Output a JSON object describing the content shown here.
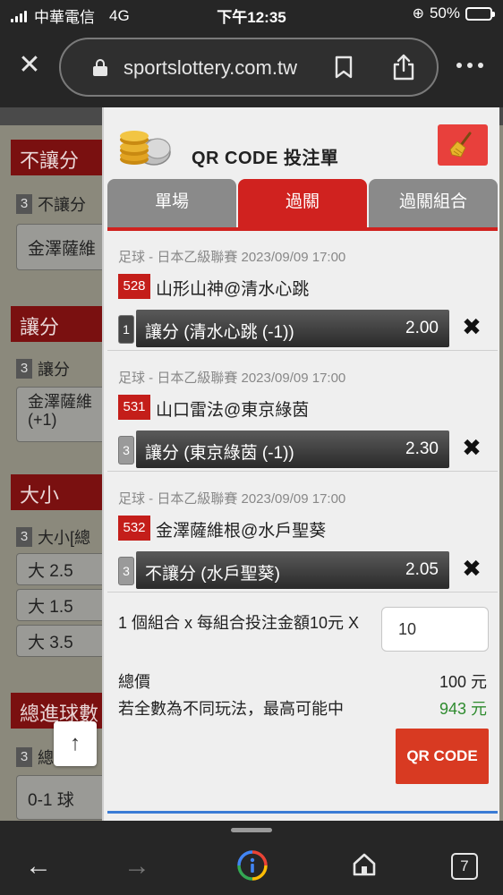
{
  "status_bar": {
    "carrier": "中華電信",
    "network": "4G",
    "time": "下午12:35",
    "battery": "50%",
    "battery_level": 0.5
  },
  "browser": {
    "url": "sportslottery.com.tw"
  },
  "background_page": {
    "sections": [
      {
        "title": "不讓分",
        "sub_count": "3",
        "sub_label": "不讓分",
        "options": [
          "金澤薩維"
        ]
      },
      {
        "title": "讓分",
        "sub_count": "3",
        "sub_label": "讓分",
        "options": [
          "金澤薩維 (+1)"
        ]
      },
      {
        "title": "大小",
        "sub_count": "3",
        "sub_label": "大小[總",
        "options": [
          "大 2.5",
          "大 1.5",
          "大 3.5"
        ]
      },
      {
        "title": "總進球數",
        "sub_count": "3",
        "sub_label": "總",
        "options": [
          "0-1 球"
        ]
      }
    ],
    "scroll_up_icon": "arrow-up-icon"
  },
  "modal": {
    "title": "QR CODE 投注單",
    "tabs": [
      {
        "label": "單場",
        "active": false
      },
      {
        "label": "過關",
        "active": true
      },
      {
        "label": "過關組合",
        "active": false
      }
    ],
    "bets": [
      {
        "league": "足球 - 日本乙級聯賽 2023/09/09 17:00",
        "number": "528",
        "match": "山形山神@清水心跳",
        "count": "1",
        "pick": "讓分 (清水心跳 (-1))",
        "odds": "2.00"
      },
      {
        "league": "足球 - 日本乙級聯賽 2023/09/09 17:00",
        "number": "531",
        "match": "山口雷法@東京綠茵",
        "count": "3",
        "pick": "讓分 (東京綠茵 (-1))",
        "odds": "2.30"
      },
      {
        "league": "足球 - 日本乙級聯賽 2023/09/09 17:00",
        "number": "532",
        "match": "金澤薩維根@水戶聖葵",
        "count": "3",
        "pick": "不讓分 (水戶聖葵)",
        "odds": "2.05"
      }
    ],
    "combo_text": "1 個組合 x 每組合投注金額10元 X",
    "amount_value": "10",
    "total_label": "總價",
    "total_value": "100 元",
    "max_label": "若全數為不同玩法，最高可能中",
    "max_value": "943 元",
    "qr_button": "QR CODE"
  },
  "bottom_nav": {
    "tab_count": "7"
  },
  "colors": {
    "accent_red": "#d0221f",
    "win_green": "#2e8b2e",
    "bar_dark": "#262626"
  }
}
